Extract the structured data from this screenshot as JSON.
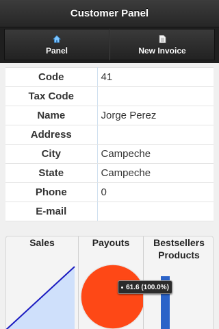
{
  "header": {
    "title": "Customer Panel"
  },
  "nav": {
    "items": [
      {
        "label": "Panel",
        "icon": "home-icon"
      },
      {
        "label": "New Invoice",
        "icon": "document-icon"
      }
    ]
  },
  "customer": {
    "rows": [
      {
        "label": "Code",
        "value": "41"
      },
      {
        "label": "Tax Code",
        "value": ""
      },
      {
        "label": "Name",
        "value": "Jorge Perez"
      },
      {
        "label": "Address",
        "value": ""
      },
      {
        "label": "City",
        "value": "Campeche"
      },
      {
        "label": "State",
        "value": "Campeche"
      },
      {
        "label": "Phone",
        "value": "0"
      },
      {
        "label": "E-mail",
        "value": ""
      }
    ]
  },
  "dashboard": {
    "sales_title": "Sales",
    "payouts_title": "Payouts",
    "bestsellers_title": "Bestsellers Products",
    "tooltip_text": "61.6 (100.0%)"
  },
  "chart_data": [
    {
      "type": "area",
      "title": "Sales",
      "series": [
        {
          "values": [
            0,
            1
          ]
        }
      ],
      "color": "#1a1ac0"
    },
    {
      "type": "pie",
      "title": "Payouts",
      "values": [
        61.6
      ],
      "percent": [
        100.0
      ],
      "colors": [
        "#fe4816"
      ]
    },
    {
      "type": "bar",
      "title": "Bestsellers Products",
      "values": [
        1
      ],
      "colors": [
        "#2b63c8"
      ]
    }
  ]
}
